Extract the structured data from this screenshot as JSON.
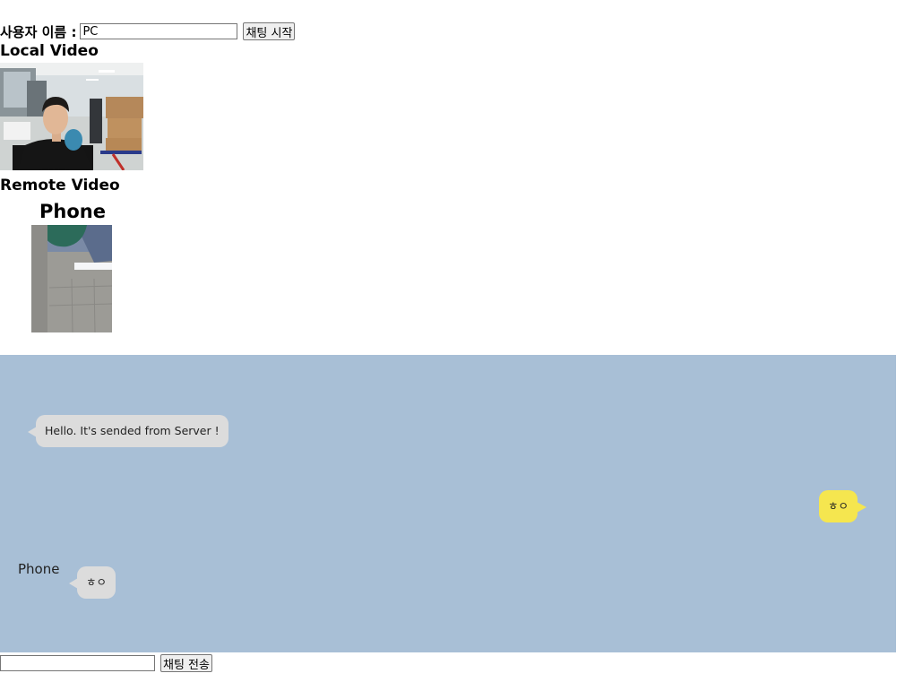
{
  "header": {
    "username_label": "사용자 이름 :",
    "username_value": "PC",
    "start_button": "채팅 시작"
  },
  "local": {
    "title": "Local Video"
  },
  "remote": {
    "title": "Remote Video",
    "peer_name": "Phone"
  },
  "chat": {
    "background_color": "#a8bfd6",
    "messages": [
      {
        "side": "left",
        "sender": "",
        "text": "Hello. It's sended from Server !"
      },
      {
        "side": "right",
        "sender": "",
        "text": "ㅎㅇ"
      },
      {
        "side": "left",
        "sender": "Phone",
        "text": "ㅎㅇ"
      }
    ]
  },
  "footer": {
    "message_value": "",
    "send_button": "채팅 전송"
  }
}
